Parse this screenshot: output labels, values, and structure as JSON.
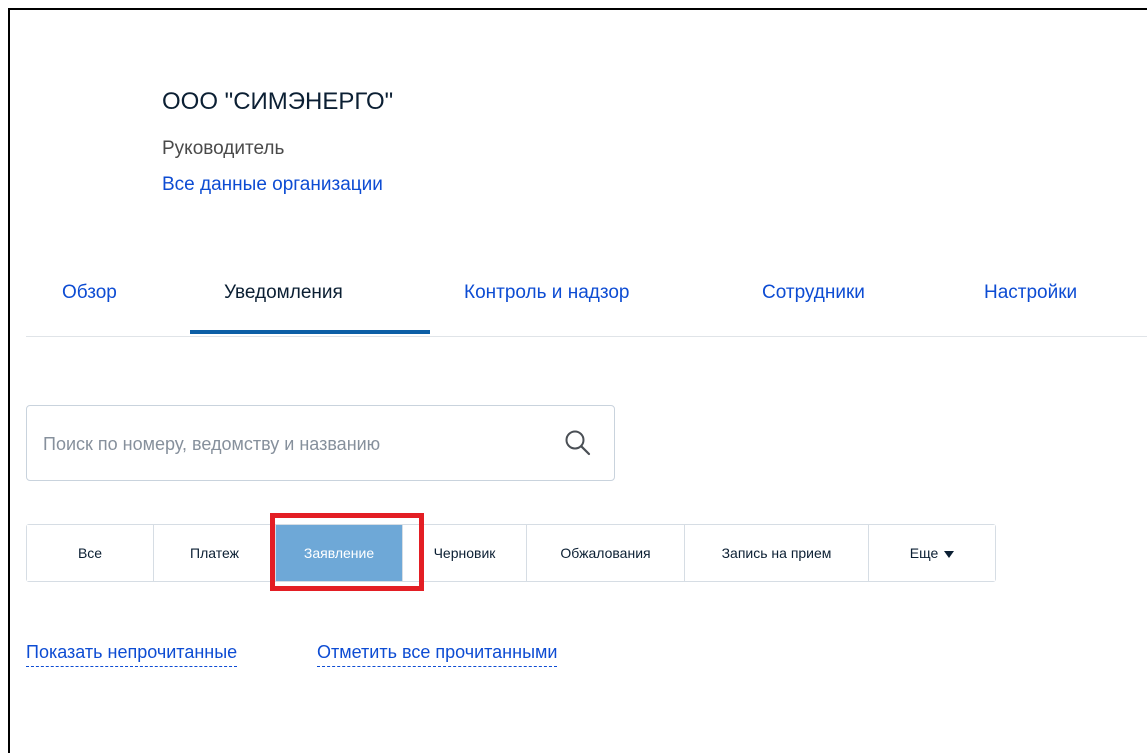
{
  "organization": {
    "name": "ООО \"СИМЭНЕРГО\"",
    "role": "Руководитель",
    "all_data_link": "Все данные организации"
  },
  "tabs": [
    {
      "label": "Обзор",
      "active": false
    },
    {
      "label": "Уведомления",
      "active": true
    },
    {
      "label": "Контроль и надзор",
      "active": false
    },
    {
      "label": "Сотрудники",
      "active": false
    },
    {
      "label": "Настройки",
      "active": false
    }
  ],
  "search": {
    "placeholder": "Поиск по номеру, ведомству и названию",
    "value": "",
    "icon": "search-icon"
  },
  "filters": [
    {
      "label": "Все",
      "active": false
    },
    {
      "label": "Платеж",
      "active": false
    },
    {
      "label": "Заявление",
      "active": true
    },
    {
      "label": "Черновик",
      "active": false
    },
    {
      "label": "Обжалования",
      "active": false
    },
    {
      "label": "Запись на прием",
      "active": false
    },
    {
      "label": "Еще",
      "active": false,
      "icon": "caret-down-icon"
    }
  ],
  "actions": {
    "show_unread": "Показать непрочитанные",
    "mark_all_read": "Отметить все прочитанными"
  },
  "colors": {
    "link": "#0d4cd3",
    "active_tab_underline": "#0d5fa6",
    "active_filter_bg": "#6ea8d7",
    "highlight": "#e31e24"
  }
}
